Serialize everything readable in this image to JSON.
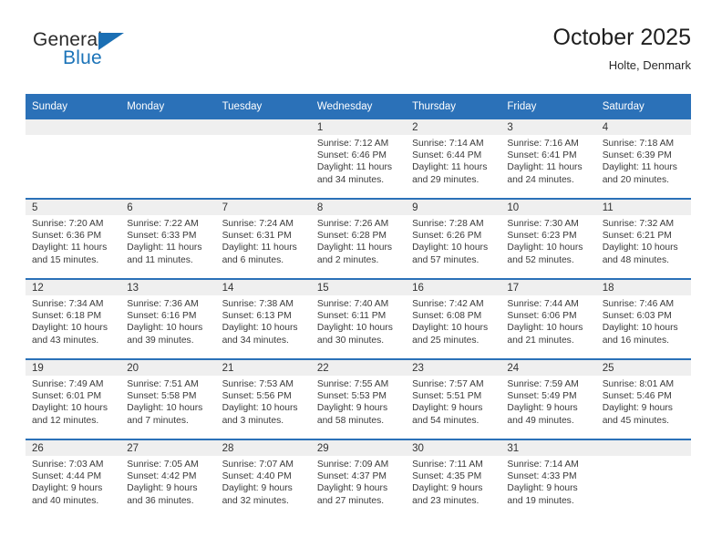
{
  "brand": {
    "name_top": "General",
    "name_bottom": "Blue",
    "colors": {
      "blue": "#1b73b8",
      "dark": "#2b2b2b"
    }
  },
  "header": {
    "title": "October 2025",
    "subtitle": "Holte, Denmark"
  },
  "theme": {
    "header_blue": "#2b71b8",
    "band_gray": "#efefef",
    "text": "#3a3a3a"
  },
  "weekday_headers": [
    "Sunday",
    "Monday",
    "Tuesday",
    "Wednesday",
    "Thursday",
    "Friday",
    "Saturday"
  ],
  "labels": {
    "sunrise_prefix": "Sunrise:",
    "sunset_prefix": "Sunset:",
    "daylight_prefix": "Daylight:"
  },
  "weeks": [
    [
      {
        "day": "",
        "empty": true
      },
      {
        "day": "",
        "empty": true
      },
      {
        "day": "",
        "empty": true
      },
      {
        "day": "1",
        "sunrise": "Sunrise: 7:12 AM",
        "sunset": "Sunset: 6:46 PM",
        "daylight1": "Daylight: 11 hours",
        "daylight2": "and 34 minutes."
      },
      {
        "day": "2",
        "sunrise": "Sunrise: 7:14 AM",
        "sunset": "Sunset: 6:44 PM",
        "daylight1": "Daylight: 11 hours",
        "daylight2": "and 29 minutes."
      },
      {
        "day": "3",
        "sunrise": "Sunrise: 7:16 AM",
        "sunset": "Sunset: 6:41 PM",
        "daylight1": "Daylight: 11 hours",
        "daylight2": "and 24 minutes."
      },
      {
        "day": "4",
        "sunrise": "Sunrise: 7:18 AM",
        "sunset": "Sunset: 6:39 PM",
        "daylight1": "Daylight: 11 hours",
        "daylight2": "and 20 minutes."
      }
    ],
    [
      {
        "day": "5",
        "sunrise": "Sunrise: 7:20 AM",
        "sunset": "Sunset: 6:36 PM",
        "daylight1": "Daylight: 11 hours",
        "daylight2": "and 15 minutes."
      },
      {
        "day": "6",
        "sunrise": "Sunrise: 7:22 AM",
        "sunset": "Sunset: 6:33 PM",
        "daylight1": "Daylight: 11 hours",
        "daylight2": "and 11 minutes."
      },
      {
        "day": "7",
        "sunrise": "Sunrise: 7:24 AM",
        "sunset": "Sunset: 6:31 PM",
        "daylight1": "Daylight: 11 hours",
        "daylight2": "and 6 minutes."
      },
      {
        "day": "8",
        "sunrise": "Sunrise: 7:26 AM",
        "sunset": "Sunset: 6:28 PM",
        "daylight1": "Daylight: 11 hours",
        "daylight2": "and 2 minutes."
      },
      {
        "day": "9",
        "sunrise": "Sunrise: 7:28 AM",
        "sunset": "Sunset: 6:26 PM",
        "daylight1": "Daylight: 10 hours",
        "daylight2": "and 57 minutes."
      },
      {
        "day": "10",
        "sunrise": "Sunrise: 7:30 AM",
        "sunset": "Sunset: 6:23 PM",
        "daylight1": "Daylight: 10 hours",
        "daylight2": "and 52 minutes."
      },
      {
        "day": "11",
        "sunrise": "Sunrise: 7:32 AM",
        "sunset": "Sunset: 6:21 PM",
        "daylight1": "Daylight: 10 hours",
        "daylight2": "and 48 minutes."
      }
    ],
    [
      {
        "day": "12",
        "sunrise": "Sunrise: 7:34 AM",
        "sunset": "Sunset: 6:18 PM",
        "daylight1": "Daylight: 10 hours",
        "daylight2": "and 43 minutes."
      },
      {
        "day": "13",
        "sunrise": "Sunrise: 7:36 AM",
        "sunset": "Sunset: 6:16 PM",
        "daylight1": "Daylight: 10 hours",
        "daylight2": "and 39 minutes."
      },
      {
        "day": "14",
        "sunrise": "Sunrise: 7:38 AM",
        "sunset": "Sunset: 6:13 PM",
        "daylight1": "Daylight: 10 hours",
        "daylight2": "and 34 minutes."
      },
      {
        "day": "15",
        "sunrise": "Sunrise: 7:40 AM",
        "sunset": "Sunset: 6:11 PM",
        "daylight1": "Daylight: 10 hours",
        "daylight2": "and 30 minutes."
      },
      {
        "day": "16",
        "sunrise": "Sunrise: 7:42 AM",
        "sunset": "Sunset: 6:08 PM",
        "daylight1": "Daylight: 10 hours",
        "daylight2": "and 25 minutes."
      },
      {
        "day": "17",
        "sunrise": "Sunrise: 7:44 AM",
        "sunset": "Sunset: 6:06 PM",
        "daylight1": "Daylight: 10 hours",
        "daylight2": "and 21 minutes."
      },
      {
        "day": "18",
        "sunrise": "Sunrise: 7:46 AM",
        "sunset": "Sunset: 6:03 PM",
        "daylight1": "Daylight: 10 hours",
        "daylight2": "and 16 minutes."
      }
    ],
    [
      {
        "day": "19",
        "sunrise": "Sunrise: 7:49 AM",
        "sunset": "Sunset: 6:01 PM",
        "daylight1": "Daylight: 10 hours",
        "daylight2": "and 12 minutes."
      },
      {
        "day": "20",
        "sunrise": "Sunrise: 7:51 AM",
        "sunset": "Sunset: 5:58 PM",
        "daylight1": "Daylight: 10 hours",
        "daylight2": "and 7 minutes."
      },
      {
        "day": "21",
        "sunrise": "Sunrise: 7:53 AM",
        "sunset": "Sunset: 5:56 PM",
        "daylight1": "Daylight: 10 hours",
        "daylight2": "and 3 minutes."
      },
      {
        "day": "22",
        "sunrise": "Sunrise: 7:55 AM",
        "sunset": "Sunset: 5:53 PM",
        "daylight1": "Daylight: 9 hours",
        "daylight2": "and 58 minutes."
      },
      {
        "day": "23",
        "sunrise": "Sunrise: 7:57 AM",
        "sunset": "Sunset: 5:51 PM",
        "daylight1": "Daylight: 9 hours",
        "daylight2": "and 54 minutes."
      },
      {
        "day": "24",
        "sunrise": "Sunrise: 7:59 AM",
        "sunset": "Sunset: 5:49 PM",
        "daylight1": "Daylight: 9 hours",
        "daylight2": "and 49 minutes."
      },
      {
        "day": "25",
        "sunrise": "Sunrise: 8:01 AM",
        "sunset": "Sunset: 5:46 PM",
        "daylight1": "Daylight: 9 hours",
        "daylight2": "and 45 minutes."
      }
    ],
    [
      {
        "day": "26",
        "sunrise": "Sunrise: 7:03 AM",
        "sunset": "Sunset: 4:44 PM",
        "daylight1": "Daylight: 9 hours",
        "daylight2": "and 40 minutes."
      },
      {
        "day": "27",
        "sunrise": "Sunrise: 7:05 AM",
        "sunset": "Sunset: 4:42 PM",
        "daylight1": "Daylight: 9 hours",
        "daylight2": "and 36 minutes."
      },
      {
        "day": "28",
        "sunrise": "Sunrise: 7:07 AM",
        "sunset": "Sunset: 4:40 PM",
        "daylight1": "Daylight: 9 hours",
        "daylight2": "and 32 minutes."
      },
      {
        "day": "29",
        "sunrise": "Sunrise: 7:09 AM",
        "sunset": "Sunset: 4:37 PM",
        "daylight1": "Daylight: 9 hours",
        "daylight2": "and 27 minutes."
      },
      {
        "day": "30",
        "sunrise": "Sunrise: 7:11 AM",
        "sunset": "Sunset: 4:35 PM",
        "daylight1": "Daylight: 9 hours",
        "daylight2": "and 23 minutes."
      },
      {
        "day": "31",
        "sunrise": "Sunrise: 7:14 AM",
        "sunset": "Sunset: 4:33 PM",
        "daylight1": "Daylight: 9 hours",
        "daylight2": "and 19 minutes."
      },
      {
        "day": "",
        "empty": true
      }
    ]
  ]
}
